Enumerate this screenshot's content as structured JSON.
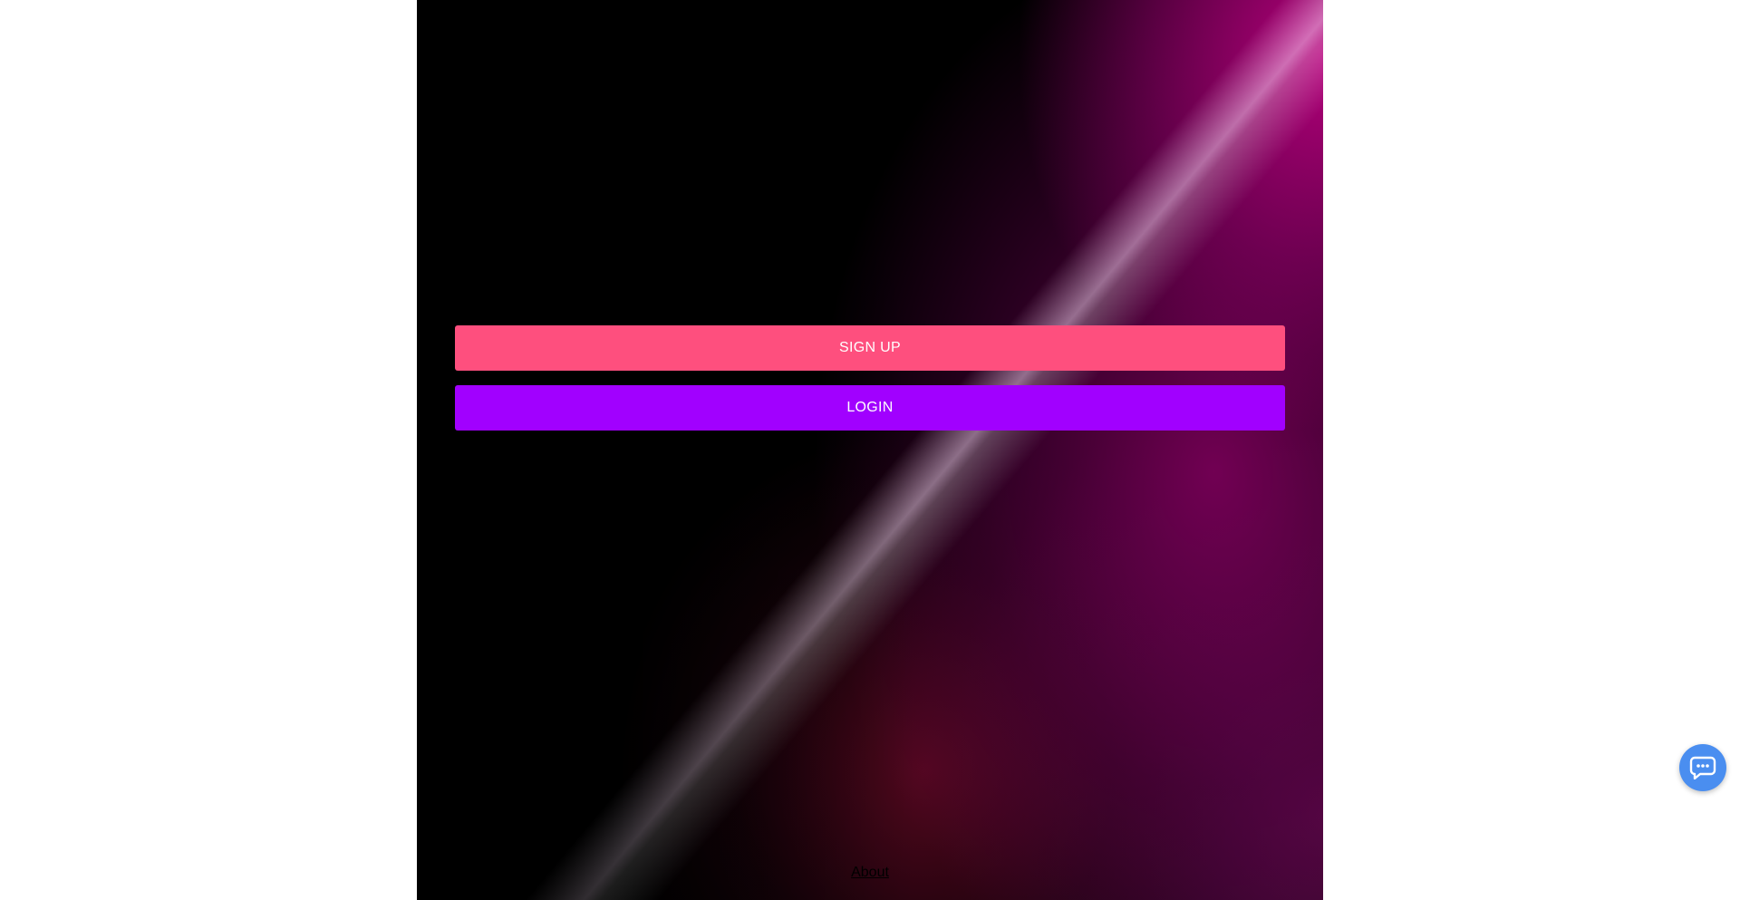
{
  "buttons": {
    "signup_label": "SIGN UP",
    "login_label": "LOGIN"
  },
  "footer": {
    "about_label": "About"
  },
  "chat": {
    "icon": "chat-bubble-icon"
  },
  "colors": {
    "signup": "#fe4f7e",
    "login": "#a100ff",
    "chat_fab": "#4a8ef0"
  }
}
